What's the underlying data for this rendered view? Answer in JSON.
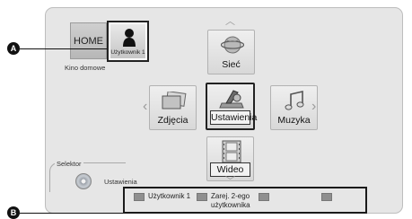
{
  "home": {
    "home_label": "HOME",
    "user_label": "Użytkownik 1",
    "subtitle": "Kino domowe"
  },
  "menu": {
    "network": "Sieć",
    "photos": "Zdjęcia",
    "settings": "Ustawienia",
    "music": "Muzyka",
    "video": "Wideo"
  },
  "selector": {
    "label": "Selektor",
    "sub_label": "Ustawienia"
  },
  "color_bar": {
    "user1": "Użytkownik 1",
    "register_line1": "Zarej. 2-ego",
    "register_line2": "użytkownika"
  },
  "callouts": {
    "a": "A",
    "b": "B"
  },
  "icons": [
    "person-icon",
    "globe-icon",
    "photos-icon",
    "settings-tools-icon",
    "music-note-icon",
    "film-icon",
    "disc-icon",
    "arrow-left-icon",
    "arrow-right-icon",
    "arrow-up-icon",
    "arrow-down-icon"
  ]
}
